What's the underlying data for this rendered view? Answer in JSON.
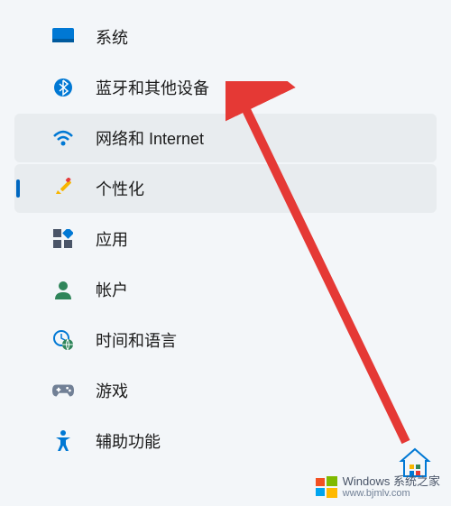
{
  "sidebar": {
    "items": [
      {
        "label": "系统",
        "icon": "system"
      },
      {
        "label": "蓝牙和其他设备",
        "icon": "bluetooth"
      },
      {
        "label": "网络和 Internet",
        "icon": "wifi"
      },
      {
        "label": "个性化",
        "icon": "personalization"
      },
      {
        "label": "应用",
        "icon": "apps"
      },
      {
        "label": "帐户",
        "icon": "account"
      },
      {
        "label": "时间和语言",
        "icon": "time"
      },
      {
        "label": "游戏",
        "icon": "gaming"
      },
      {
        "label": "辅助功能",
        "icon": "accessibility"
      }
    ]
  },
  "watermark": {
    "brand": "Windows 系统之家",
    "url": "www.bjmlv.com"
  },
  "annotation": {
    "arrow_target": "蓝牙和其他设备"
  }
}
